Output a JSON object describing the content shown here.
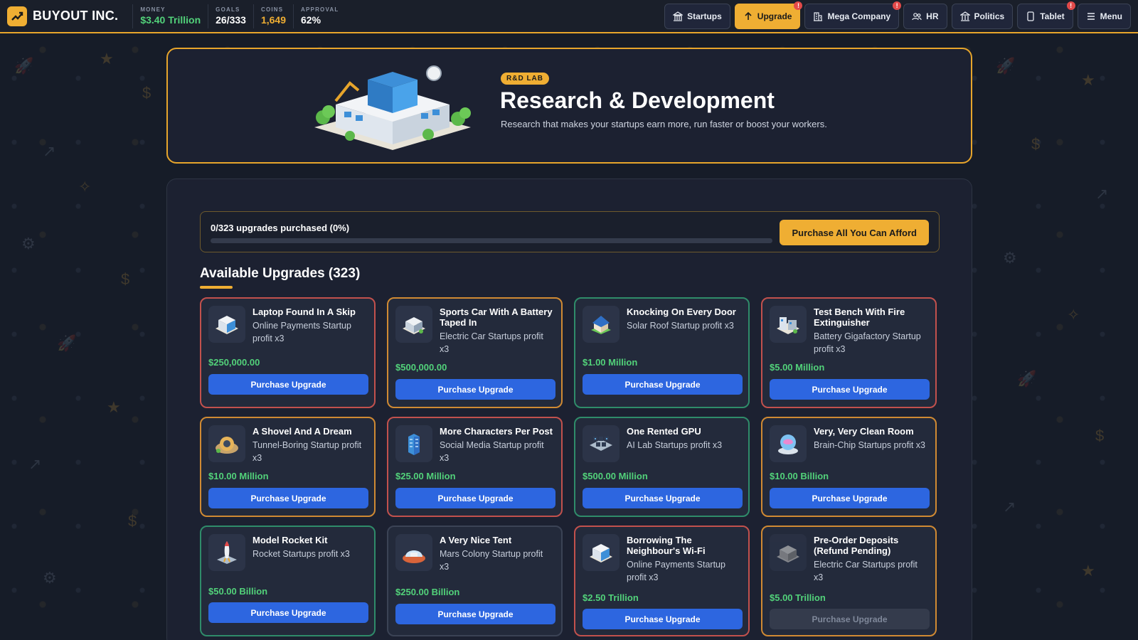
{
  "topbar": {
    "brand": "BUYOUT INC.",
    "stats": [
      {
        "label": "MONEY",
        "value": "$3.40 Trillion",
        "color": "#52d27a"
      },
      {
        "label": "GOALS",
        "value": "26/333",
        "color": "#ffffff"
      },
      {
        "label": "COINS",
        "value": "1,649",
        "color": "#efae33"
      },
      {
        "label": "APPROVAL",
        "value": "62%",
        "color": "#ffffff"
      }
    ],
    "nav": [
      {
        "label": "Startups",
        "icon": "bank-icon",
        "active": false,
        "notif": ""
      },
      {
        "label": "Upgrade",
        "icon": "arrow-up-icon",
        "active": true,
        "notif": "!"
      },
      {
        "label": "Mega Company",
        "icon": "building-icon",
        "active": false,
        "notif": "!"
      },
      {
        "label": "HR",
        "icon": "people-icon",
        "active": false,
        "notif": ""
      },
      {
        "label": "Politics",
        "icon": "capitol-icon",
        "active": false,
        "notif": ""
      },
      {
        "label": "Tablet",
        "icon": "tablet-icon",
        "active": false,
        "notif": "!"
      },
      {
        "label": "Menu",
        "icon": "menu-icon",
        "active": false,
        "notif": ""
      }
    ]
  },
  "hero": {
    "badge": "R&D LAB",
    "title": "Research & Development",
    "description": "Research that makes your startups earn more, run faster or boost your workers."
  },
  "progress": {
    "text": "0/323 upgrades purchased (0%)",
    "fraction": 0,
    "buy_all_label": "Purchase All You Can Afford"
  },
  "section": {
    "title": "Available Upgrades (323)"
  },
  "colors": {
    "accent": "#efae33",
    "price_green": "#52d27a",
    "button_blue": "#2d66e0",
    "tier_red": "#c2514d",
    "tier_orange": "#d08a33",
    "tier_green": "#2f8c6a"
  },
  "upgrades": [
    {
      "title": "Laptop Found In A Skip",
      "desc": "Online Payments Startup profit x3",
      "price": "$250,000.00",
      "button": "Purchase Upgrade",
      "tier": "red",
      "icon": "office-building-icon",
      "enabled": true
    },
    {
      "title": "Sports Car With A Battery Taped In",
      "desc": "Electric Car Startups profit x3",
      "price": "$500,000.00",
      "button": "Purchase Upgrade",
      "tier": "orange",
      "icon": "factory-icon",
      "enabled": true
    },
    {
      "title": "Knocking On Every Door",
      "desc": "Solar Roof Startup profit x3",
      "price": "$1.00 Million",
      "button": "Purchase Upgrade",
      "tier": "green",
      "icon": "solar-house-icon",
      "enabled": true
    },
    {
      "title": "Test Bench With Fire Extinguisher",
      "desc": "Battery Gigafactory Startup profit x3",
      "price": "$5.00 Million",
      "button": "Purchase Upgrade",
      "tier": "red",
      "icon": "gigafactory-icon",
      "enabled": true
    },
    {
      "title": "A Shovel And A Dream",
      "desc": "Tunnel-Boring Startup profit x3",
      "price": "$10.00 Million",
      "button": "Purchase Upgrade",
      "tier": "orange",
      "icon": "tunnel-icon",
      "enabled": true
    },
    {
      "title": "More Characters Per Post",
      "desc": "Social Media Startup profit x3",
      "price": "$25.00 Million",
      "button": "Purchase Upgrade",
      "tier": "red",
      "icon": "tower-icon",
      "enabled": true
    },
    {
      "title": "One Rented GPU",
      "desc": "AI Lab Startups profit x3",
      "price": "$500.00 Million",
      "button": "Purchase Upgrade",
      "tier": "green",
      "icon": "server-grid-icon",
      "enabled": true
    },
    {
      "title": "Very, Very Clean Room",
      "desc": "Brain-Chip Startups profit x3",
      "price": "$10.00 Billion",
      "button": "Purchase Upgrade",
      "tier": "orange",
      "icon": "brain-lab-icon",
      "enabled": true
    },
    {
      "title": "Model Rocket Kit",
      "desc": "Rocket Startups profit x3",
      "price": "$50.00 Billion",
      "button": "Purchase Upgrade",
      "tier": "green",
      "icon": "rocket-icon",
      "enabled": true
    },
    {
      "title": "A Very Nice Tent",
      "desc": "Mars Colony Startup profit x3",
      "price": "$250.00 Billion",
      "button": "Purchase Upgrade",
      "tier": "none",
      "icon": "mars-dome-icon",
      "enabled": true
    },
    {
      "title": "Borrowing The Neighbour's Wi-Fi",
      "desc": "Online Payments Startup profit x3",
      "price": "$2.50 Trillion",
      "button": "Purchase Upgrade",
      "tier": "red",
      "icon": "office-building-icon",
      "enabled": true
    },
    {
      "title": "Pre-Order Deposits (Refund Pending)",
      "desc": "Electric Car Startups profit x3",
      "price": "$5.00 Trillion",
      "button": "Purchase Upgrade",
      "tier": "orange",
      "icon": "factory-icon",
      "enabled": false
    }
  ]
}
